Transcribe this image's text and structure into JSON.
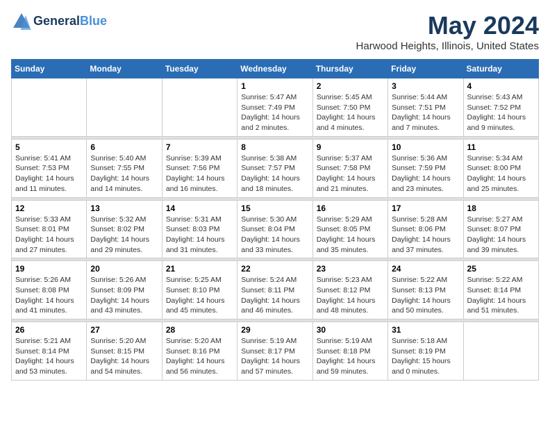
{
  "header": {
    "logo_line1": "General",
    "logo_line2": "Blue",
    "month": "May 2024",
    "location": "Harwood Heights, Illinois, United States"
  },
  "weekdays": [
    "Sunday",
    "Monday",
    "Tuesday",
    "Wednesday",
    "Thursday",
    "Friday",
    "Saturday"
  ],
  "weeks": [
    [
      null,
      null,
      null,
      {
        "day": 1,
        "sunrise": "5:47 AM",
        "sunset": "7:49 PM",
        "daylight": "14 hours and 2 minutes."
      },
      {
        "day": 2,
        "sunrise": "5:45 AM",
        "sunset": "7:50 PM",
        "daylight": "14 hours and 4 minutes."
      },
      {
        "day": 3,
        "sunrise": "5:44 AM",
        "sunset": "7:51 PM",
        "daylight": "14 hours and 7 minutes."
      },
      {
        "day": 4,
        "sunrise": "5:43 AM",
        "sunset": "7:52 PM",
        "daylight": "14 hours and 9 minutes."
      }
    ],
    [
      {
        "day": 5,
        "sunrise": "5:41 AM",
        "sunset": "7:53 PM",
        "daylight": "14 hours and 11 minutes."
      },
      {
        "day": 6,
        "sunrise": "5:40 AM",
        "sunset": "7:55 PM",
        "daylight": "14 hours and 14 minutes."
      },
      {
        "day": 7,
        "sunrise": "5:39 AM",
        "sunset": "7:56 PM",
        "daylight": "14 hours and 16 minutes."
      },
      {
        "day": 8,
        "sunrise": "5:38 AM",
        "sunset": "7:57 PM",
        "daylight": "14 hours and 18 minutes."
      },
      {
        "day": 9,
        "sunrise": "5:37 AM",
        "sunset": "7:58 PM",
        "daylight": "14 hours and 21 minutes."
      },
      {
        "day": 10,
        "sunrise": "5:36 AM",
        "sunset": "7:59 PM",
        "daylight": "14 hours and 23 minutes."
      },
      {
        "day": 11,
        "sunrise": "5:34 AM",
        "sunset": "8:00 PM",
        "daylight": "14 hours and 25 minutes."
      }
    ],
    [
      {
        "day": 12,
        "sunrise": "5:33 AM",
        "sunset": "8:01 PM",
        "daylight": "14 hours and 27 minutes."
      },
      {
        "day": 13,
        "sunrise": "5:32 AM",
        "sunset": "8:02 PM",
        "daylight": "14 hours and 29 minutes."
      },
      {
        "day": 14,
        "sunrise": "5:31 AM",
        "sunset": "8:03 PM",
        "daylight": "14 hours and 31 minutes."
      },
      {
        "day": 15,
        "sunrise": "5:30 AM",
        "sunset": "8:04 PM",
        "daylight": "14 hours and 33 minutes."
      },
      {
        "day": 16,
        "sunrise": "5:29 AM",
        "sunset": "8:05 PM",
        "daylight": "14 hours and 35 minutes."
      },
      {
        "day": 17,
        "sunrise": "5:28 AM",
        "sunset": "8:06 PM",
        "daylight": "14 hours and 37 minutes."
      },
      {
        "day": 18,
        "sunrise": "5:27 AM",
        "sunset": "8:07 PM",
        "daylight": "14 hours and 39 minutes."
      }
    ],
    [
      {
        "day": 19,
        "sunrise": "5:26 AM",
        "sunset": "8:08 PM",
        "daylight": "14 hours and 41 minutes."
      },
      {
        "day": 20,
        "sunrise": "5:26 AM",
        "sunset": "8:09 PM",
        "daylight": "14 hours and 43 minutes."
      },
      {
        "day": 21,
        "sunrise": "5:25 AM",
        "sunset": "8:10 PM",
        "daylight": "14 hours and 45 minutes."
      },
      {
        "day": 22,
        "sunrise": "5:24 AM",
        "sunset": "8:11 PM",
        "daylight": "14 hours and 46 minutes."
      },
      {
        "day": 23,
        "sunrise": "5:23 AM",
        "sunset": "8:12 PM",
        "daylight": "14 hours and 48 minutes."
      },
      {
        "day": 24,
        "sunrise": "5:22 AM",
        "sunset": "8:13 PM",
        "daylight": "14 hours and 50 minutes."
      },
      {
        "day": 25,
        "sunrise": "5:22 AM",
        "sunset": "8:14 PM",
        "daylight": "14 hours and 51 minutes."
      }
    ],
    [
      {
        "day": 26,
        "sunrise": "5:21 AM",
        "sunset": "8:14 PM",
        "daylight": "14 hours and 53 minutes."
      },
      {
        "day": 27,
        "sunrise": "5:20 AM",
        "sunset": "8:15 PM",
        "daylight": "14 hours and 54 minutes."
      },
      {
        "day": 28,
        "sunrise": "5:20 AM",
        "sunset": "8:16 PM",
        "daylight": "14 hours and 56 minutes."
      },
      {
        "day": 29,
        "sunrise": "5:19 AM",
        "sunset": "8:17 PM",
        "daylight": "14 hours and 57 minutes."
      },
      {
        "day": 30,
        "sunrise": "5:19 AM",
        "sunset": "8:18 PM",
        "daylight": "14 hours and 59 minutes."
      },
      {
        "day": 31,
        "sunrise": "5:18 AM",
        "sunset": "8:19 PM",
        "daylight": "15 hours and 0 minutes."
      },
      null
    ]
  ]
}
